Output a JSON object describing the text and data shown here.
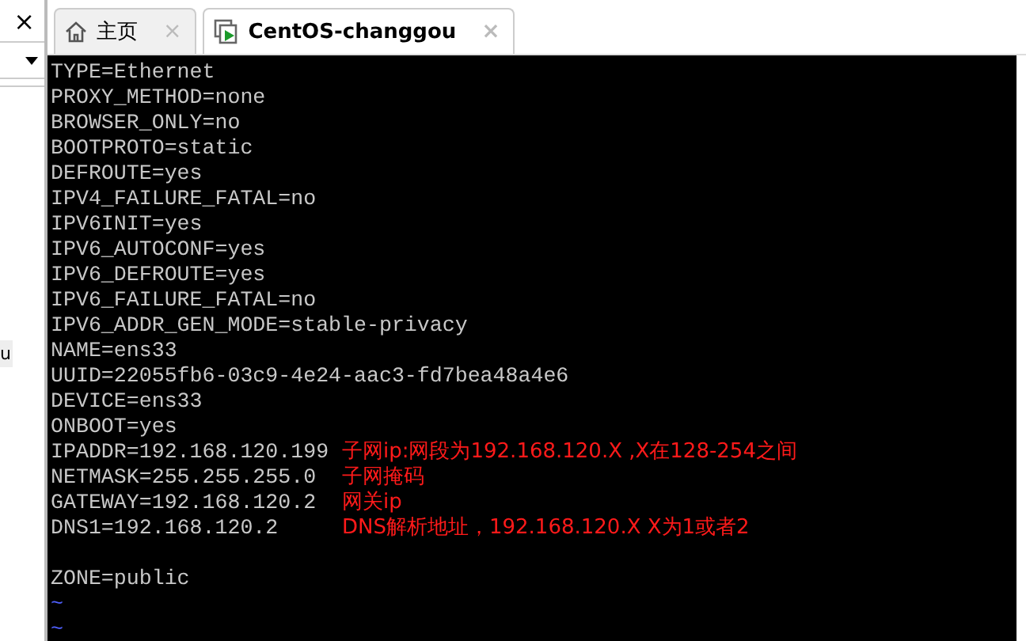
{
  "side_panel": {
    "close": "×",
    "partial_text": "u"
  },
  "tabs": [
    {
      "label": "主页",
      "selected": false,
      "close": "×",
      "kind": "home"
    },
    {
      "label": "CentOS-changgou",
      "selected": true,
      "close": "×",
      "kind": "vm"
    }
  ],
  "terminal": {
    "lines": [
      {
        "kind": "text",
        "text": "TYPE=Ethernet"
      },
      {
        "kind": "text",
        "text": "PROXY_METHOD=none"
      },
      {
        "kind": "text",
        "text": "BROWSER_ONLY=no"
      },
      {
        "kind": "text",
        "text": "BOOTPROTO=static"
      },
      {
        "kind": "text",
        "text": "DEFROUTE=yes"
      },
      {
        "kind": "text",
        "text": "IPV4_FAILURE_FATAL=no"
      },
      {
        "kind": "text",
        "text": "IPV6INIT=yes"
      },
      {
        "kind": "text",
        "text": "IPV6_AUTOCONF=yes"
      },
      {
        "kind": "text",
        "text": "IPV6_DEFROUTE=yes"
      },
      {
        "kind": "text",
        "text": "IPV6_FAILURE_FATAL=no"
      },
      {
        "kind": "text",
        "text": "IPV6_ADDR_GEN_MODE=stable-privacy"
      },
      {
        "kind": "text",
        "text": "NAME=ens33"
      },
      {
        "kind": "text",
        "text": "UUID=22055fb6-03c9-4e24-aac3-fd7bea48a4e6"
      },
      {
        "kind": "text",
        "text": "DEVICE=ens33"
      },
      {
        "kind": "text",
        "text": "ONBOOT=yes"
      },
      {
        "kind": "text",
        "text": "IPADDR=192.168.120.199",
        "note": "子网ip:网段为192.168.120.X ,X在128-254之间"
      },
      {
        "kind": "text",
        "text": "NETMASK=255.255.255.0",
        "note": "子网掩码"
      },
      {
        "kind": "text",
        "text": "GATEWAY=192.168.120.2",
        "note": "网关ip"
      },
      {
        "kind": "text",
        "text": "DNS1=192.168.120.2",
        "note": "DNS解析地址，192.168.120.X X为1或者2"
      },
      {
        "kind": "blank"
      },
      {
        "kind": "text",
        "text": "ZONE=public"
      },
      {
        "kind": "tilde",
        "text": "~"
      },
      {
        "kind": "tilde",
        "text": "~"
      }
    ]
  }
}
